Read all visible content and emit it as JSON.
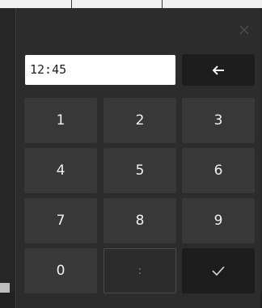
{
  "display": {
    "value": "12:45"
  },
  "keys": {
    "k1": "1",
    "k2": "2",
    "k3": "3",
    "k4": "4",
    "k5": "5",
    "k6": "6",
    "k7": "7",
    "k8": "8",
    "k9": "9",
    "k0": "0",
    "colon": ":"
  },
  "icons": {
    "close": "close-icon",
    "backspace": "arrow-left-icon",
    "confirm": "check-icon"
  },
  "colors": {
    "dialog_bg": "#2c2c2c",
    "key_bg": "#383838",
    "action_bg": "#1d1d1d",
    "display_bg": "#ffffff"
  }
}
